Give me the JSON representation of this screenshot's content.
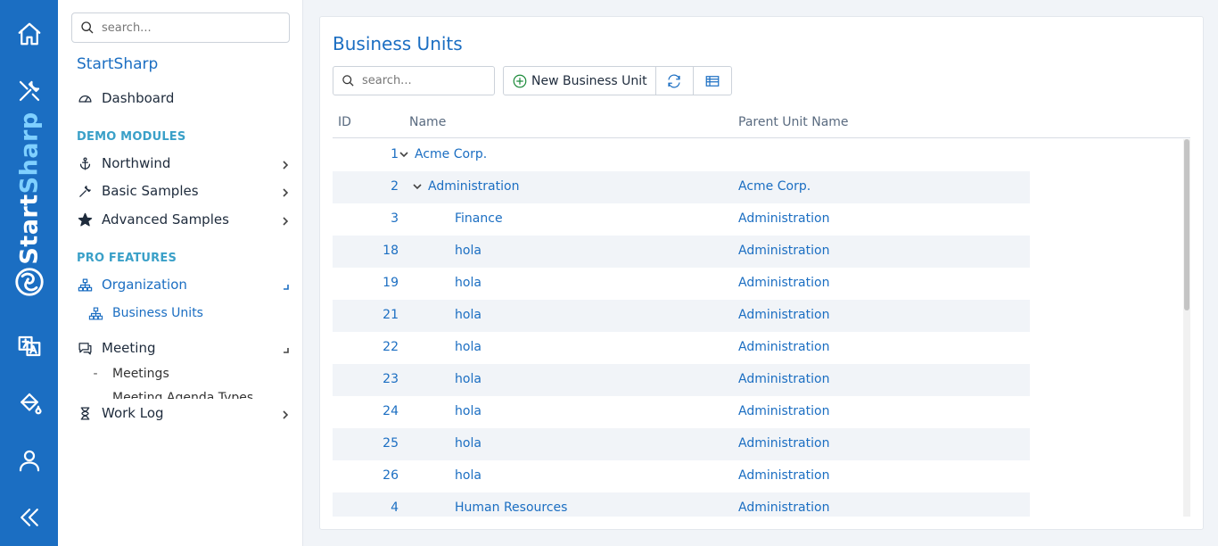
{
  "rail": {
    "brand_part1": "Start",
    "brand_part2": "Sharp",
    "icons": [
      "home-icon",
      "tools-icon",
      "translate-icon",
      "paint-bucket-icon",
      "user-icon",
      "collapse-icon"
    ]
  },
  "sidebar": {
    "search_placeholder": "search...",
    "app_title": "StartSharp",
    "dashboard": "Dashboard",
    "demo_modules_header": "DEMO MODULES",
    "northwind": "Northwind",
    "basic_samples": "Basic Samples",
    "advanced_samples": "Advanced Samples",
    "pro_features_header": "PRO FEATURES",
    "organization": "Organization",
    "business_units": "Business Units",
    "meeting": "Meeting",
    "meetings": "Meetings",
    "meeting_agenda_types": "Meeting Agenda Types",
    "work_log": "Work Log"
  },
  "main": {
    "title": "Business Units",
    "search_placeholder": "search...",
    "new_button": "New Business Unit",
    "columns": {
      "id": "ID",
      "name": "Name",
      "parent": "Parent Unit Name"
    },
    "rows": [
      {
        "id": "1",
        "name": "Acme Corp.",
        "parent": "",
        "level": 0,
        "expander": true
      },
      {
        "id": "2",
        "name": "Administration",
        "parent": "Acme Corp.",
        "level": 1,
        "expander": true
      },
      {
        "id": "3",
        "name": "Finance",
        "parent": "Administration",
        "level": 2,
        "expander": false
      },
      {
        "id": "18",
        "name": "hola",
        "parent": "Administration",
        "level": 2,
        "expander": false
      },
      {
        "id": "19",
        "name": "hola",
        "parent": "Administration",
        "level": 2,
        "expander": false
      },
      {
        "id": "21",
        "name": "hola",
        "parent": "Administration",
        "level": 2,
        "expander": false
      },
      {
        "id": "22",
        "name": "hola",
        "parent": "Administration",
        "level": 2,
        "expander": false
      },
      {
        "id": "23",
        "name": "hola",
        "parent": "Administration",
        "level": 2,
        "expander": false
      },
      {
        "id": "24",
        "name": "hola",
        "parent": "Administration",
        "level": 2,
        "expander": false
      },
      {
        "id": "25",
        "name": "hola",
        "parent": "Administration",
        "level": 2,
        "expander": false
      },
      {
        "id": "26",
        "name": "hola",
        "parent": "Administration",
        "level": 2,
        "expander": false
      },
      {
        "id": "4",
        "name": "Human Resources",
        "parent": "Administration",
        "level": 2,
        "expander": false
      }
    ]
  },
  "colors": {
    "brand": "#1b6ec2",
    "section": "#3aa0c8",
    "rowAlt": "#f1f4f8"
  }
}
